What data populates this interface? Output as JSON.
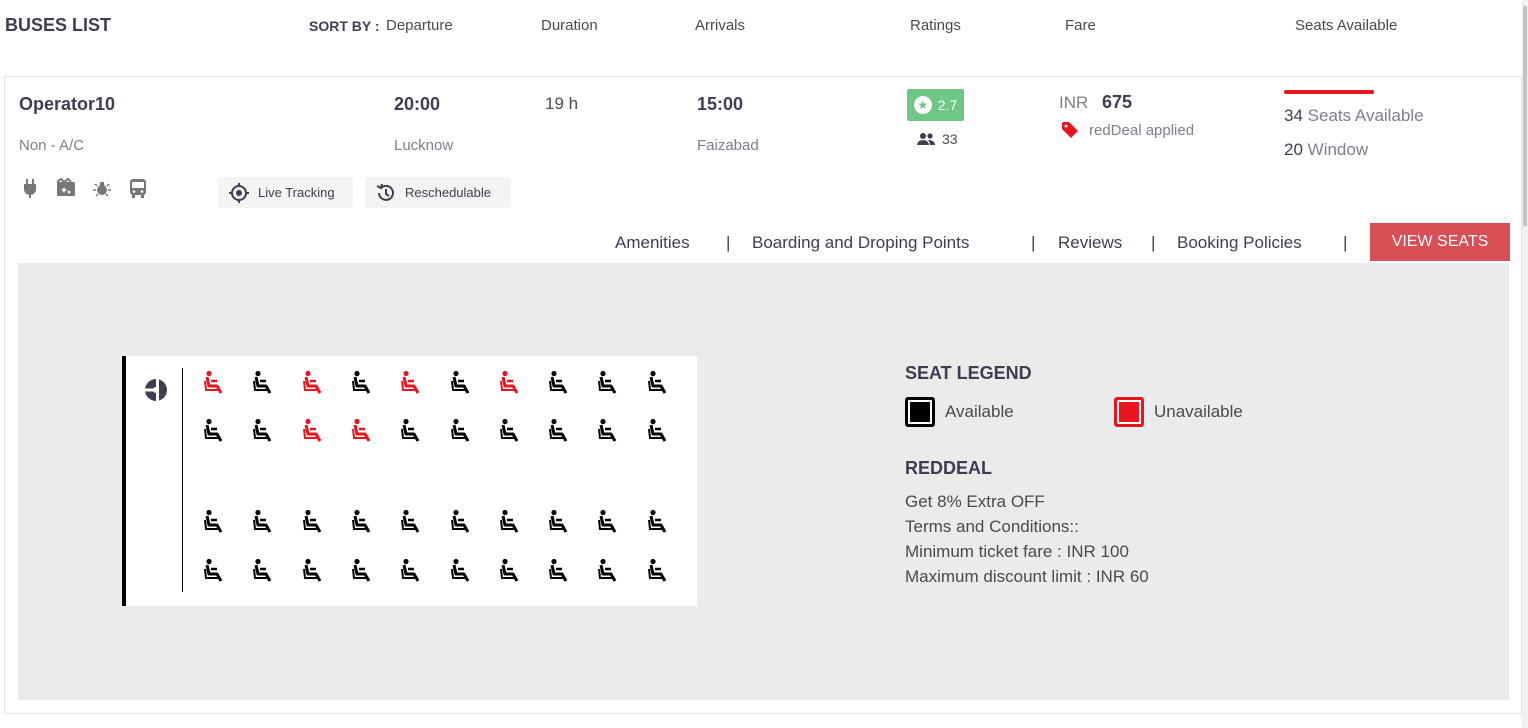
{
  "header": {
    "title": "BUSES LIST",
    "sort_by": "SORT BY :",
    "cols": {
      "departure": "Departure",
      "duration": "Duration",
      "arrivals": "Arrivals",
      "ratings": "Ratings",
      "fare": "Fare",
      "seats_available": "Seats Available"
    }
  },
  "bus": {
    "operator": "Operator10",
    "type": "Non - A/C",
    "amenities": [
      "plug-icon",
      "movie-icon",
      "reading-light-icon",
      "bus-icon"
    ],
    "chips": {
      "live_tracking": "Live Tracking",
      "reschedulable": "Reschedulable"
    },
    "departure_time": "20:00",
    "departure_city": "Lucknow",
    "duration": "19 h",
    "arrival_time": "15:00",
    "arrival_city": "Faizabad",
    "rating": "2.7",
    "review_count": "33",
    "fare_currency": "INR",
    "fare": "675",
    "reddeal_applied": "redDeal applied",
    "seats_count": "34",
    "seats_label": "Seats Available",
    "window_count": "20",
    "window_label": "Window"
  },
  "tabs": {
    "amenities": "Amenities",
    "boarding": "Boarding and Droping Points",
    "reviews": "Reviews",
    "policies": "Booking Policies",
    "separator": "|",
    "view_seats": "VIEW SEATS"
  },
  "seat_layout": {
    "rows": [
      [
        "U",
        "A",
        "U",
        "A",
        "U",
        "A",
        "U",
        "A",
        "A",
        "A"
      ],
      [
        "A",
        "A",
        "U",
        "U",
        "A",
        "A",
        "A",
        "A",
        "A",
        "A"
      ],
      [
        "A",
        "A",
        "A",
        "A",
        "A",
        "A",
        "A",
        "A",
        "A",
        "A"
      ],
      [
        "A",
        "A",
        "A",
        "A",
        "A",
        "A",
        "A",
        "A",
        "A",
        "A"
      ]
    ],
    "available_color": "#000000",
    "unavailable_color": "#e8151f"
  },
  "legend": {
    "title": "SEAT LEGEND",
    "available": "Available",
    "unavailable": "Unavailable"
  },
  "reddeal": {
    "title": "REDDEAL",
    "lines": [
      "Get 8% Extra OFF",
      "Terms and Conditions::",
      "Minimum ticket fare : INR 100",
      "Maximum discount limit : INR 60"
    ]
  },
  "colors": {
    "accent": "#d84e55",
    "rating_bg": "#6dc785",
    "deal_red": "#e8151f",
    "panel_bg": "#ebebeb"
  }
}
